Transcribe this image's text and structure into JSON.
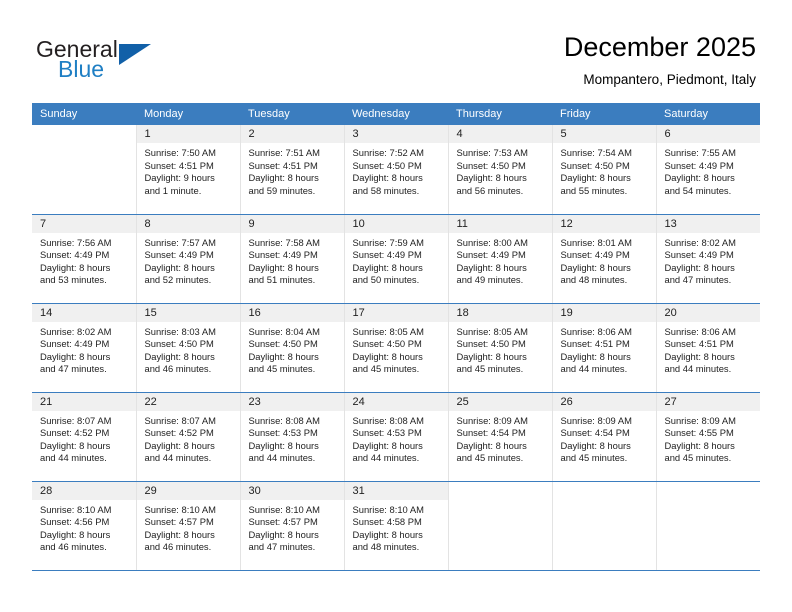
{
  "brand": {
    "name_top": "General",
    "name_bottom": "Blue",
    "triangle_icon": "blue-triangle-icon",
    "color_dark": "#231f20",
    "color_blue": "#1f7fc4",
    "color_triangle": "#1160a8"
  },
  "header": {
    "title": "December 2025",
    "subtitle": "Mompantero, Piedmont, Italy"
  },
  "theme": {
    "header_row_bg": "#3b7dbf",
    "header_row_text": "#ffffff",
    "daynum_bg": "#f0f0f0",
    "cell_text": "#222222",
    "row_divider": "#3b7dbf"
  },
  "weekdays": [
    "Sunday",
    "Monday",
    "Tuesday",
    "Wednesday",
    "Thursday",
    "Friday",
    "Saturday"
  ],
  "weeks": [
    [
      {
        "day": "",
        "lines": []
      },
      {
        "day": "1",
        "lines": [
          "Sunrise: 7:50 AM",
          "Sunset: 4:51 PM",
          "Daylight: 9 hours",
          "and 1 minute."
        ]
      },
      {
        "day": "2",
        "lines": [
          "Sunrise: 7:51 AM",
          "Sunset: 4:51 PM",
          "Daylight: 8 hours",
          "and 59 minutes."
        ]
      },
      {
        "day": "3",
        "lines": [
          "Sunrise: 7:52 AM",
          "Sunset: 4:50 PM",
          "Daylight: 8 hours",
          "and 58 minutes."
        ]
      },
      {
        "day": "4",
        "lines": [
          "Sunrise: 7:53 AM",
          "Sunset: 4:50 PM",
          "Daylight: 8 hours",
          "and 56 minutes."
        ]
      },
      {
        "day": "5",
        "lines": [
          "Sunrise: 7:54 AM",
          "Sunset: 4:50 PM",
          "Daylight: 8 hours",
          "and 55 minutes."
        ]
      },
      {
        "day": "6",
        "lines": [
          "Sunrise: 7:55 AM",
          "Sunset: 4:49 PM",
          "Daylight: 8 hours",
          "and 54 minutes."
        ]
      }
    ],
    [
      {
        "day": "7",
        "lines": [
          "Sunrise: 7:56 AM",
          "Sunset: 4:49 PM",
          "Daylight: 8 hours",
          "and 53 minutes."
        ]
      },
      {
        "day": "8",
        "lines": [
          "Sunrise: 7:57 AM",
          "Sunset: 4:49 PM",
          "Daylight: 8 hours",
          "and 52 minutes."
        ]
      },
      {
        "day": "9",
        "lines": [
          "Sunrise: 7:58 AM",
          "Sunset: 4:49 PM",
          "Daylight: 8 hours",
          "and 51 minutes."
        ]
      },
      {
        "day": "10",
        "lines": [
          "Sunrise: 7:59 AM",
          "Sunset: 4:49 PM",
          "Daylight: 8 hours",
          "and 50 minutes."
        ]
      },
      {
        "day": "11",
        "lines": [
          "Sunrise: 8:00 AM",
          "Sunset: 4:49 PM",
          "Daylight: 8 hours",
          "and 49 minutes."
        ]
      },
      {
        "day": "12",
        "lines": [
          "Sunrise: 8:01 AM",
          "Sunset: 4:49 PM",
          "Daylight: 8 hours",
          "and 48 minutes."
        ]
      },
      {
        "day": "13",
        "lines": [
          "Sunrise: 8:02 AM",
          "Sunset: 4:49 PM",
          "Daylight: 8 hours",
          "and 47 minutes."
        ]
      }
    ],
    [
      {
        "day": "14",
        "lines": [
          "Sunrise: 8:02 AM",
          "Sunset: 4:49 PM",
          "Daylight: 8 hours",
          "and 47 minutes."
        ]
      },
      {
        "day": "15",
        "lines": [
          "Sunrise: 8:03 AM",
          "Sunset: 4:50 PM",
          "Daylight: 8 hours",
          "and 46 minutes."
        ]
      },
      {
        "day": "16",
        "lines": [
          "Sunrise: 8:04 AM",
          "Sunset: 4:50 PM",
          "Daylight: 8 hours",
          "and 45 minutes."
        ]
      },
      {
        "day": "17",
        "lines": [
          "Sunrise: 8:05 AM",
          "Sunset: 4:50 PM",
          "Daylight: 8 hours",
          "and 45 minutes."
        ]
      },
      {
        "day": "18",
        "lines": [
          "Sunrise: 8:05 AM",
          "Sunset: 4:50 PM",
          "Daylight: 8 hours",
          "and 45 minutes."
        ]
      },
      {
        "day": "19",
        "lines": [
          "Sunrise: 8:06 AM",
          "Sunset: 4:51 PM",
          "Daylight: 8 hours",
          "and 44 minutes."
        ]
      },
      {
        "day": "20",
        "lines": [
          "Sunrise: 8:06 AM",
          "Sunset: 4:51 PM",
          "Daylight: 8 hours",
          "and 44 minutes."
        ]
      }
    ],
    [
      {
        "day": "21",
        "lines": [
          "Sunrise: 8:07 AM",
          "Sunset: 4:52 PM",
          "Daylight: 8 hours",
          "and 44 minutes."
        ]
      },
      {
        "day": "22",
        "lines": [
          "Sunrise: 8:07 AM",
          "Sunset: 4:52 PM",
          "Daylight: 8 hours",
          "and 44 minutes."
        ]
      },
      {
        "day": "23",
        "lines": [
          "Sunrise: 8:08 AM",
          "Sunset: 4:53 PM",
          "Daylight: 8 hours",
          "and 44 minutes."
        ]
      },
      {
        "day": "24",
        "lines": [
          "Sunrise: 8:08 AM",
          "Sunset: 4:53 PM",
          "Daylight: 8 hours",
          "and 44 minutes."
        ]
      },
      {
        "day": "25",
        "lines": [
          "Sunrise: 8:09 AM",
          "Sunset: 4:54 PM",
          "Daylight: 8 hours",
          "and 45 minutes."
        ]
      },
      {
        "day": "26",
        "lines": [
          "Sunrise: 8:09 AM",
          "Sunset: 4:54 PM",
          "Daylight: 8 hours",
          "and 45 minutes."
        ]
      },
      {
        "day": "27",
        "lines": [
          "Sunrise: 8:09 AM",
          "Sunset: 4:55 PM",
          "Daylight: 8 hours",
          "and 45 minutes."
        ]
      }
    ],
    [
      {
        "day": "28",
        "lines": [
          "Sunrise: 8:10 AM",
          "Sunset: 4:56 PM",
          "Daylight: 8 hours",
          "and 46 minutes."
        ]
      },
      {
        "day": "29",
        "lines": [
          "Sunrise: 8:10 AM",
          "Sunset: 4:57 PM",
          "Daylight: 8 hours",
          "and 46 minutes."
        ]
      },
      {
        "day": "30",
        "lines": [
          "Sunrise: 8:10 AM",
          "Sunset: 4:57 PM",
          "Daylight: 8 hours",
          "and 47 minutes."
        ]
      },
      {
        "day": "31",
        "lines": [
          "Sunrise: 8:10 AM",
          "Sunset: 4:58 PM",
          "Daylight: 8 hours",
          "and 48 minutes."
        ]
      },
      {
        "day": "",
        "lines": []
      },
      {
        "day": "",
        "lines": []
      },
      {
        "day": "",
        "lines": []
      }
    ]
  ]
}
